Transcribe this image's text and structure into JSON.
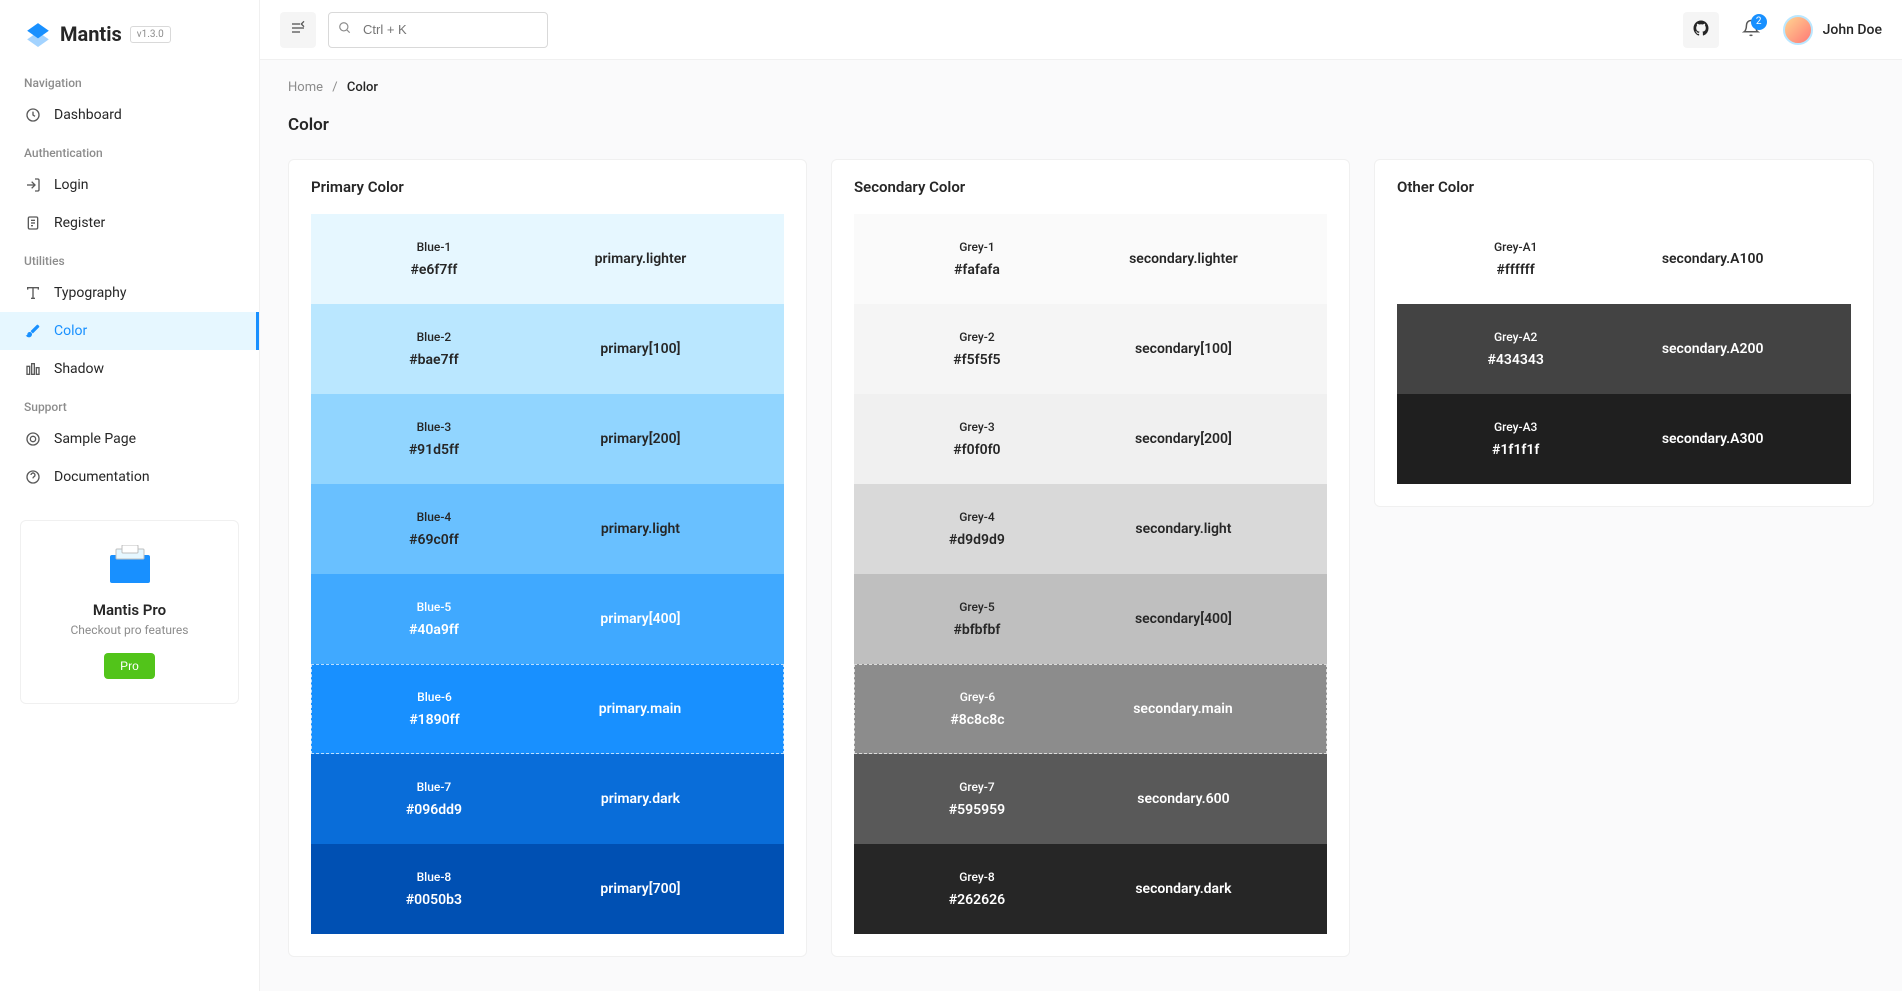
{
  "app": {
    "name": "Mantis",
    "version": "v1.3.0"
  },
  "search": {
    "placeholder": "Ctrl + K"
  },
  "user": {
    "name": "John Doe"
  },
  "notifications": {
    "count": "2"
  },
  "breadcrumb": {
    "home": "Home",
    "current": "Color"
  },
  "page": {
    "title": "Color"
  },
  "sidebar": {
    "groups": [
      {
        "title": "Navigation",
        "items": [
          {
            "label": "Dashboard",
            "icon": "dashboard"
          }
        ]
      },
      {
        "title": "Authentication",
        "items": [
          {
            "label": "Login",
            "icon": "login"
          },
          {
            "label": "Register",
            "icon": "register"
          }
        ]
      },
      {
        "title": "Utilities",
        "items": [
          {
            "label": "Typography",
            "icon": "typography"
          },
          {
            "label": "Color",
            "icon": "color",
            "active": true
          },
          {
            "label": "Shadow",
            "icon": "shadow"
          }
        ]
      },
      {
        "title": "Support",
        "items": [
          {
            "label": "Sample Page",
            "icon": "sample"
          },
          {
            "label": "Documentation",
            "icon": "docs"
          }
        ]
      }
    ]
  },
  "pro": {
    "title": "Mantis Pro",
    "subtitle": "Checkout pro features",
    "button": "Pro"
  },
  "palettes": [
    {
      "title": "Primary Color",
      "id": "primary",
      "swatches": [
        {
          "name": "Blue-1",
          "hex": "#e6f7ff",
          "token": "primary.lighter",
          "textDark": true
        },
        {
          "name": "Blue-2",
          "hex": "#bae7ff",
          "token": "primary[100]",
          "textDark": true
        },
        {
          "name": "Blue-3",
          "hex": "#91d5ff",
          "token": "primary[200]",
          "textDark": true
        },
        {
          "name": "Blue-4",
          "hex": "#69c0ff",
          "token": "primary.light",
          "textDark": true
        },
        {
          "name": "Blue-5",
          "hex": "#40a9ff",
          "token": "primary[400]",
          "textDark": false
        },
        {
          "name": "Blue-6",
          "hex": "#1890ff",
          "token": "primary.main",
          "textDark": false,
          "main": true
        },
        {
          "name": "Blue-7",
          "hex": "#096dd9",
          "token": "primary.dark",
          "textDark": false
        },
        {
          "name": "Blue-8",
          "hex": "#0050b3",
          "token": "primary[700]",
          "textDark": false
        }
      ]
    },
    {
      "title": "Secondary Color",
      "id": "secondary",
      "swatches": [
        {
          "name": "Grey-1",
          "hex": "#fafafa",
          "token": "secondary.lighter",
          "textDark": true
        },
        {
          "name": "Grey-2",
          "hex": "#f5f5f5",
          "token": "secondary[100]",
          "textDark": true
        },
        {
          "name": "Grey-3",
          "hex": "#f0f0f0",
          "token": "secondary[200]",
          "textDark": true
        },
        {
          "name": "Grey-4",
          "hex": "#d9d9d9",
          "token": "secondary.light",
          "textDark": true
        },
        {
          "name": "Grey-5",
          "hex": "#bfbfbf",
          "token": "secondary[400]",
          "textDark": true
        },
        {
          "name": "Grey-6",
          "hex": "#8c8c8c",
          "token": "secondary.main",
          "textDark": false,
          "main": true
        },
        {
          "name": "Grey-7",
          "hex": "#595959",
          "token": "secondary.600",
          "textDark": false
        },
        {
          "name": "Grey-8",
          "hex": "#262626",
          "token": "secondary.dark",
          "textDark": false
        }
      ]
    },
    {
      "title": "Other Color",
      "id": "other",
      "swatches": [
        {
          "name": "Grey-A1",
          "hex": "#ffffff",
          "token": "secondary.A100",
          "textDark": true
        },
        {
          "name": "Grey-A2",
          "hex": "#434343",
          "token": "secondary.A200",
          "textDark": false
        },
        {
          "name": "Grey-A3",
          "hex": "#1f1f1f",
          "token": "secondary.A300",
          "textDark": false
        }
      ]
    }
  ]
}
